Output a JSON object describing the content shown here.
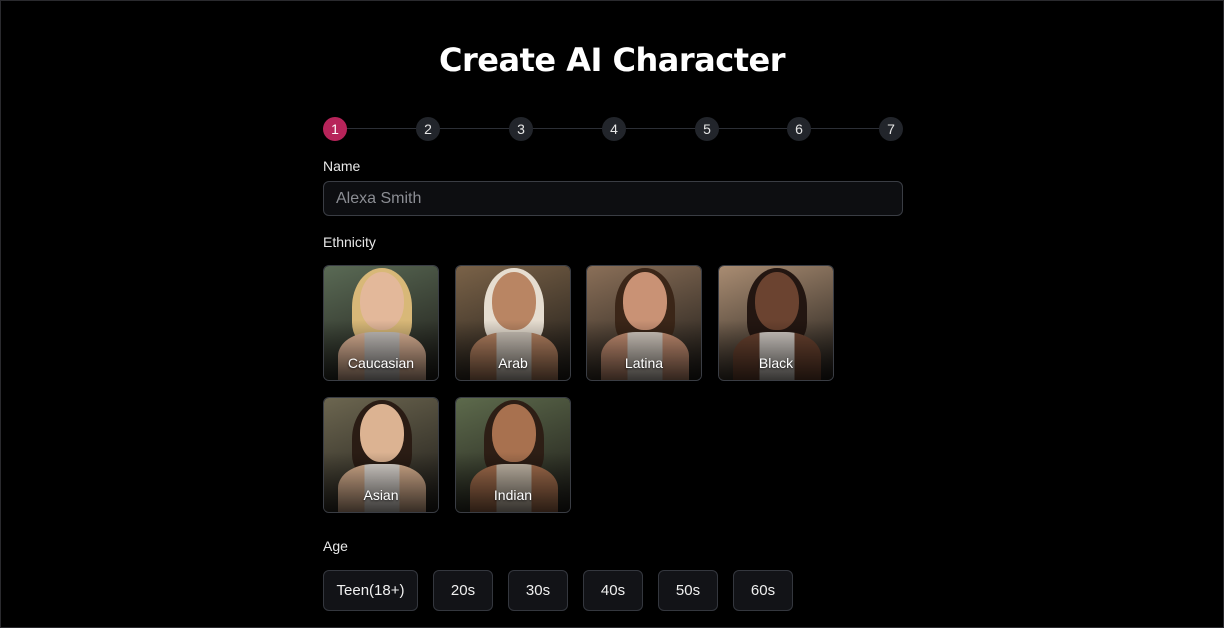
{
  "header": {
    "title": "Create AI Character"
  },
  "stepper": {
    "active": 1,
    "steps": [
      "1",
      "2",
      "3",
      "4",
      "5",
      "6",
      "7"
    ]
  },
  "name": {
    "label": "Name",
    "placeholder": "Alexa Smith",
    "value": ""
  },
  "ethnicity": {
    "label": "Ethnicity",
    "options": [
      {
        "label": "Caucasian",
        "bg": "#5a6a55",
        "skin": "#e3b89a",
        "hair": "#d8b878",
        "top": "#c9c4c0"
      },
      {
        "label": "Arab",
        "bg": "#7a6248",
        "skin": "#b98563",
        "hair": "#e6ddd0",
        "top": "#cfc6bb"
      },
      {
        "label": "Latina",
        "bg": "#8a6f58",
        "skin": "#c99275",
        "hair": "#3b2618",
        "top": "#d8cfc5"
      },
      {
        "label": "Black",
        "bg": "#a98c72",
        "skin": "#6b4330",
        "hair": "#231611",
        "top": "#d6d0ca"
      },
      {
        "label": "Asian",
        "bg": "#6c6650",
        "skin": "#dcb392",
        "hair": "#2a1c14",
        "top": "#e2dcd6"
      },
      {
        "label": "Indian",
        "bg": "#5d6a4c",
        "skin": "#a8714f",
        "hair": "#2d1e15",
        "top": "#cbbfae"
      }
    ]
  },
  "age": {
    "label": "Age",
    "options": [
      "Teen(18+)",
      "20s",
      "30s",
      "40s",
      "50s",
      "60s"
    ]
  },
  "colors": {
    "background": "#000000",
    "accent": "#b7245a",
    "step_inactive": "#22252b",
    "border": "#3a3d44"
  }
}
